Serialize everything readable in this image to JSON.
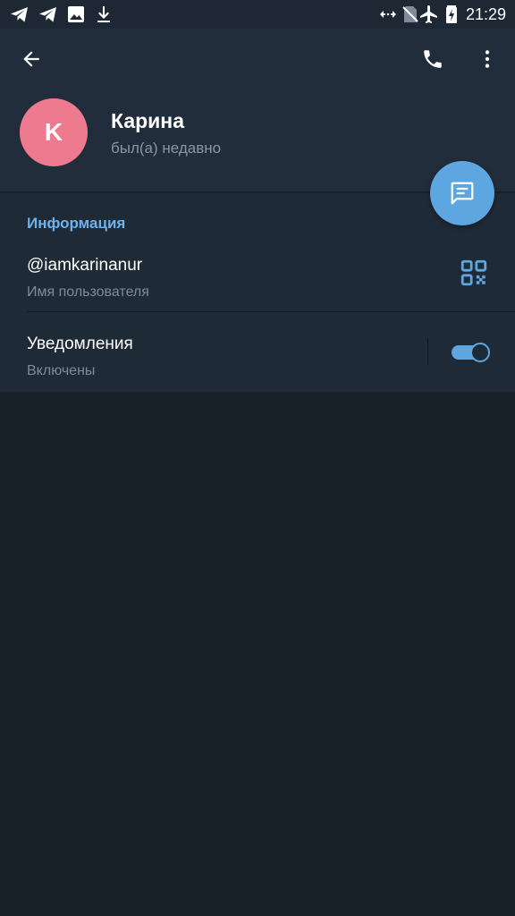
{
  "status_bar": {
    "time": "21:29",
    "left_icons": [
      "telegram-icon",
      "telegram-icon",
      "image-icon",
      "download-icon"
    ],
    "right_icons": [
      "data-transfer-icon",
      "no-sim-icon",
      "airplane-mode-icon",
      "battery-charging-icon"
    ]
  },
  "header": {
    "back_icon": "arrow-back-icon",
    "call_icon": "phone-icon",
    "menu_icon": "more-vertical-icon"
  },
  "profile": {
    "avatar_letter": "K",
    "avatar_color": "#ee7a8f",
    "name": "Карина",
    "status": "был(а) недавно"
  },
  "fab": {
    "icon": "message-icon",
    "color": "#5ea6e0"
  },
  "info": {
    "title": "Информация",
    "username": {
      "value": "@iamkarinanur",
      "label": "Имя пользователя",
      "icon": "qr-code-icon"
    },
    "notifications": {
      "label": "Уведомления",
      "value": "Включены",
      "enabled": true
    }
  },
  "colors": {
    "accent": "#5ea6e0",
    "section_title": "#6cb3ee",
    "background": "#18202a",
    "header_bg": "#212d3b",
    "section_bg": "#1f2a37"
  }
}
